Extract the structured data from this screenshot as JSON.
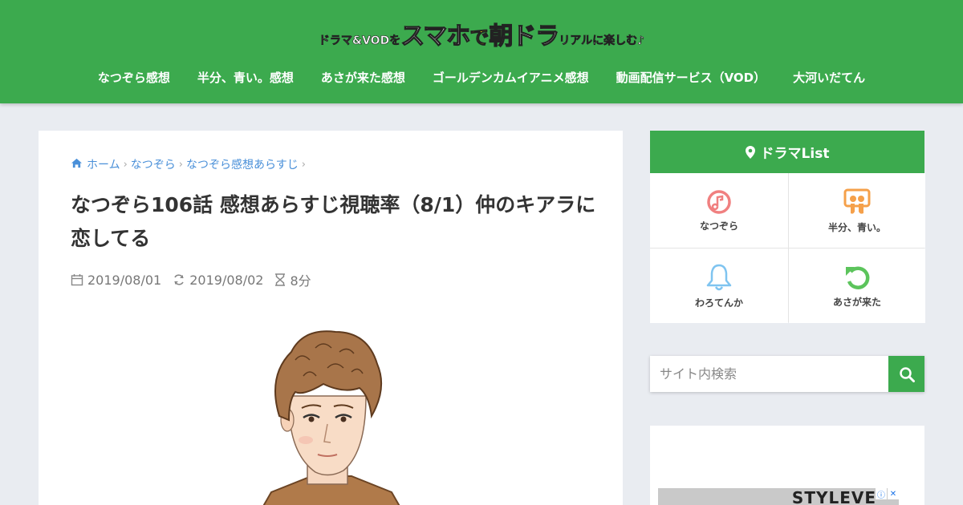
{
  "header": {
    "logo": {
      "part1": "ドラマ&VODを",
      "part2": "スマホ",
      "part3": "で",
      "part4": "朝ドラ",
      "part5": "リアルに楽しむ♪"
    },
    "nav": [
      {
        "label": "なつぞら感想"
      },
      {
        "label": "半分、青い。感想"
      },
      {
        "label": "あさが来た感想"
      },
      {
        "label": "ゴールデンカムイアニメ感想"
      },
      {
        "label": "動画配信サービス（VOD）"
      },
      {
        "label": "大河いだてん"
      }
    ]
  },
  "breadcrumb": {
    "home": "ホーム",
    "item1": "なつぞら",
    "item2": "なつぞら感想あらすじ"
  },
  "article": {
    "title": "なつぞら106話 感想あらすじ視聴率（8/1）仲のキアラに恋してる",
    "published": "2019/08/01",
    "updated": "2019/08/02",
    "read_time": "8分"
  },
  "sidebar": {
    "title": "ドラマList",
    "items": [
      {
        "label": "なつぞら",
        "icon": "music-note-icon",
        "color": "#f08080"
      },
      {
        "label": "半分、青い。",
        "icon": "slideshare-icon",
        "color": "#f5a04a"
      },
      {
        "label": "わろてんか",
        "icon": "bell-icon",
        "color": "#7fc4f0"
      },
      {
        "label": "あさが来た",
        "icon": "undo-icon",
        "color": "#5cc45c"
      }
    ]
  },
  "search": {
    "placeholder": "サイト内検索"
  },
  "ad": {
    "text": "STYLEVE"
  },
  "colors": {
    "brand_green": "#3caa4e",
    "link_blue": "#4a90d9",
    "background": "#e9ecf1"
  }
}
